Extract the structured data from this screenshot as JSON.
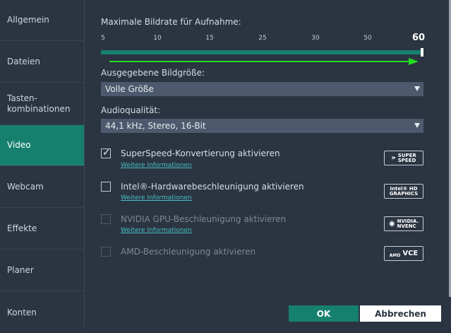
{
  "sidebar": {
    "items": [
      {
        "label": "Allgemein"
      },
      {
        "label": "Dateien"
      },
      {
        "label": "Tasten-\nkombinationen"
      },
      {
        "label": "Video"
      },
      {
        "label": "Webcam"
      },
      {
        "label": "Effekte"
      },
      {
        "label": "Planer"
      },
      {
        "label": "Konten"
      }
    ],
    "active": "Video"
  },
  "framerate": {
    "label": "Maximale Bildrate für Aufnahme:",
    "ticks": [
      "5",
      "10",
      "15",
      "25",
      "30",
      "50",
      "60"
    ],
    "value": 60
  },
  "output_size": {
    "label": "Ausgegebene Bildgröße:",
    "value": "Volle Größe"
  },
  "audio": {
    "label": "Audioqualität:",
    "value": "44,1 kHz, Stereo, 16-Bit"
  },
  "options": [
    {
      "label": "SuperSpeed-Konvertierung aktivieren",
      "more": "Weitere Informationen",
      "checked": true,
      "enabled": true,
      "badge": "SUPER SPEED"
    },
    {
      "label": "Intel®-Hardwarebeschleunigung aktivieren",
      "more": "Weitere Informationen",
      "checked": false,
      "enabled": true,
      "badge": "Intel® HD GRAPHICS"
    },
    {
      "label": "NVIDIA GPU-Beschleunigung aktivieren",
      "more": "Weitere Informationen",
      "checked": false,
      "enabled": false,
      "badge": "NVIDIA. NVENC"
    },
    {
      "label": "AMD-Beschleunigung aktivieren",
      "checked": false,
      "enabled": false,
      "badge": "AMD VCE"
    }
  ],
  "badges": {
    "superspeed": [
      "SUPER",
      "SPEED"
    ],
    "intel": [
      "Intel® HD",
      "GRAPHICS"
    ],
    "nvidia": [
      "NVIDIA.",
      "NVENC"
    ],
    "amd": [
      "AMD",
      "VCE"
    ]
  },
  "buttons": {
    "ok": "OK",
    "cancel": "Abbrechen"
  },
  "colors": {
    "accent": "#16806f",
    "background": "#2b3441",
    "select_bg": "#4d5a6d",
    "link": "#46c0c4",
    "arrow": "#22dd22"
  }
}
